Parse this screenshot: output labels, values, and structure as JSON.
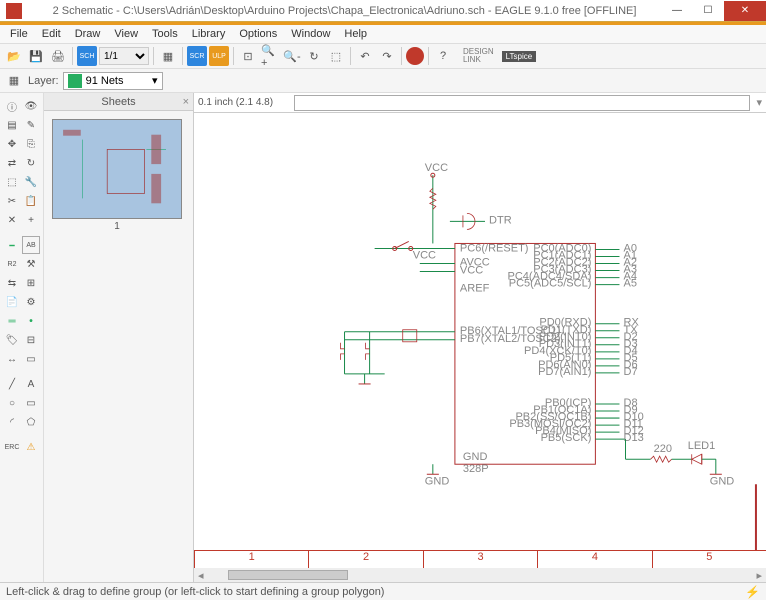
{
  "title": "2 Schematic - C:\\Users\\Adrián\\Desktop\\Arduino Projects\\Chapa_Electronica\\Adriuno.sch - EAGLE 9.1.0 free [OFFLINE]",
  "menu": {
    "file": "File",
    "edit": "Edit",
    "draw": "Draw",
    "view": "View",
    "tools": "Tools",
    "library": "Library",
    "options": "Options",
    "window": "Window",
    "help": "Help"
  },
  "toolbar": {
    "zoom": "1/1"
  },
  "subtoolbar": {
    "layer_label": "Layer:",
    "layer_value": "91 Nets"
  },
  "sheets": {
    "header": "Sheets",
    "thumb_num": "1"
  },
  "canvas": {
    "coord": "0.1 inch (2.1 4.8)",
    "cmd": ""
  },
  "ruler": {
    "t1": "1",
    "t2": "2",
    "t3": "3",
    "t4": "4",
    "t5": "5"
  },
  "status": {
    "hint": "Left-click & drag to define group (or left-click to start defining a group polygon)"
  },
  "schematic": {
    "vcc": "VCC",
    "dtr": "DTR",
    "gnd": "GND",
    "gnd2": "GND",
    "gnd3": "GND",
    "aref": "AREF",
    "avcc": "AVCC",
    "part": "328P",
    "led": "LED1",
    "res": "220",
    "pins_left": [
      "PC6(/RESET)",
      "",
      "AVCC",
      "VCC",
      "",
      "AREF",
      "",
      "",
      "",
      "PB6(XTAL1/TOSC1)",
      "PB7(XTAL2/TOSC2)"
    ],
    "pins_right_top": [
      "PC0(ADC0)",
      "PC1(ADC1)",
      "PC2(ADC2)",
      "PC3(ADC3)",
      "PC4(ADC4/SDA)",
      "PC5(ADC5/SCL)"
    ],
    "pins_right_mid": [
      "PD0(RXD)",
      "PD1(TXD)",
      "PD2(INT0)",
      "PD3(INT1)",
      "PD4(XCK/T0)",
      "PD5(T1)",
      "PD6(AIN0)",
      "PD7(AIN1)"
    ],
    "pins_right_bot": [
      "PB0(ICP)",
      "PB1(OC1A)",
      "PB2(SS/OC1B)",
      "PB3(MOSI/OC2)",
      "PB4(MISO)",
      "PB5(SCK)"
    ],
    "nets_a": [
      "A0",
      "A1",
      "A2",
      "A3",
      "A4",
      "A5"
    ],
    "nets_d_top": [
      "RX",
      "TX",
      "D2",
      "D3",
      "D4",
      "D5",
      "D6",
      "D7"
    ],
    "nets_d_bot": [
      "D8",
      "D9",
      "D10",
      "D11",
      "D12",
      "D13"
    ]
  },
  "logos": {
    "design": "DESIGN\nLINK",
    "ltc": "LTspice"
  }
}
